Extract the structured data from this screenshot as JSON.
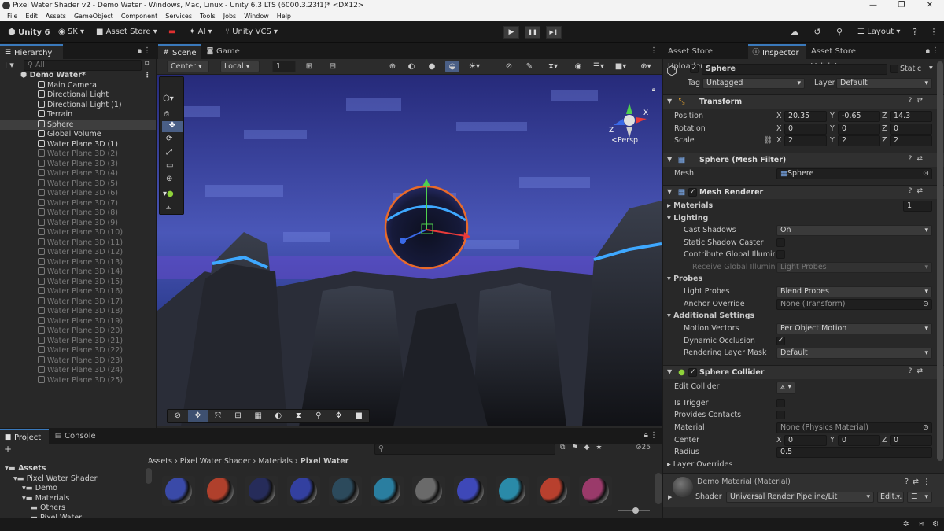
{
  "window": {
    "title": "Pixel Water Shader v2 - Demo Water - Windows, Mac, Linux - Unity 6.3 LTS (6000.3.23f1)* <DX12>",
    "controls": [
      "—",
      "❐",
      "✕"
    ]
  },
  "menu": [
    "File",
    "Edit",
    "Assets",
    "GameObject",
    "Component",
    "Services",
    "Tools",
    "Jobs",
    "Window",
    "Help"
  ],
  "toolbar": {
    "unity_label": "Unity 6",
    "account_label": "SK",
    "asset_store_label": "Asset Store",
    "ai_label": "AI",
    "vcs_label": "Unity VCS",
    "layout_label": "Layout",
    "play_glyph": "▶",
    "pause_glyph": "❚❚",
    "step_glyph": "▶❙"
  },
  "hierarchy": {
    "tab_label": "Hierarchy",
    "search_placeholder": "All",
    "scene_name": "Demo Water*",
    "items": [
      {
        "label": "Main Camera",
        "dim": false,
        "selected": false
      },
      {
        "label": "Directional Light",
        "dim": false,
        "selected": false
      },
      {
        "label": "Directional Light (1)",
        "dim": false,
        "selected": false
      },
      {
        "label": "Terrain",
        "dim": false,
        "selected": false
      },
      {
        "label": "Sphere",
        "dim": false,
        "selected": true
      },
      {
        "label": "Global Volume",
        "dim": false,
        "selected": false
      },
      {
        "label": "Water Plane 3D (1)",
        "dim": false,
        "selected": false
      },
      {
        "label": "Water Plane 3D (2)",
        "dim": true,
        "selected": false
      },
      {
        "label": "Water Plane 3D (3)",
        "dim": true,
        "selected": false
      },
      {
        "label": "Water Plane 3D (4)",
        "dim": true,
        "selected": false
      },
      {
        "label": "Water Plane 3D (5)",
        "dim": true,
        "selected": false
      },
      {
        "label": "Water Plane 3D (6)",
        "dim": true,
        "selected": false
      },
      {
        "label": "Water Plane 3D (7)",
        "dim": true,
        "selected": false
      },
      {
        "label": "Water Plane 3D (8)",
        "dim": true,
        "selected": false
      },
      {
        "label": "Water Plane 3D (9)",
        "dim": true,
        "selected": false
      },
      {
        "label": "Water Plane 3D (10)",
        "dim": true,
        "selected": false
      },
      {
        "label": "Water Plane 3D (11)",
        "dim": true,
        "selected": false
      },
      {
        "label": "Water Plane 3D (12)",
        "dim": true,
        "selected": false
      },
      {
        "label": "Water Plane 3D (13)",
        "dim": true,
        "selected": false
      },
      {
        "label": "Water Plane 3D (14)",
        "dim": true,
        "selected": false
      },
      {
        "label": "Water Plane 3D (15)",
        "dim": true,
        "selected": false
      },
      {
        "label": "Water Plane 3D (16)",
        "dim": true,
        "selected": false
      },
      {
        "label": "Water Plane 3D (17)",
        "dim": true,
        "selected": false
      },
      {
        "label": "Water Plane 3D (18)",
        "dim": true,
        "selected": false
      },
      {
        "label": "Water Plane 3D (19)",
        "dim": true,
        "selected": false
      },
      {
        "label": "Water Plane 3D (20)",
        "dim": true,
        "selected": false
      },
      {
        "label": "Water Plane 3D (21)",
        "dim": true,
        "selected": false
      },
      {
        "label": "Water Plane 3D (22)",
        "dim": true,
        "selected": false
      },
      {
        "label": "Water Plane 3D (23)",
        "dim": true,
        "selected": false
      },
      {
        "label": "Water Plane 3D (24)",
        "dim": true,
        "selected": false
      },
      {
        "label": "Water Plane 3D (25)",
        "dim": true,
        "selected": false
      }
    ]
  },
  "scene": {
    "tabs": [
      {
        "label": "Scene",
        "icon": "grid-icon"
      },
      {
        "label": "Game",
        "icon": "gamepad-icon"
      }
    ],
    "pivot_label": "Center",
    "space_label": "Local",
    "grid_size": "1",
    "persp_label": "<Persp",
    "gizmo_axes": {
      "x": "X",
      "z": "Z"
    }
  },
  "inspector": {
    "tabs": [
      "Asset Store Uploader",
      "Inspector",
      "Asset Store Validator"
    ],
    "object_name": "Sphere",
    "static_label": "Static",
    "tag_label": "Tag",
    "tag_value": "Untagged",
    "layer_label": "Layer",
    "layer_value": "Default",
    "transform": {
      "title": "Transform",
      "position_label": "Position",
      "rotation_label": "Rotation",
      "scale_label": "Scale",
      "position": [
        "20.35",
        "-0.65",
        "14.3"
      ],
      "rotation": [
        "0",
        "0",
        "0"
      ],
      "scale": [
        "2",
        "2",
        "2"
      ],
      "axes": [
        "X",
        "Y",
        "Z"
      ]
    },
    "mesh_filter": {
      "title": "Sphere (Mesh Filter)",
      "mesh_label": "Mesh",
      "mesh_value": "Sphere"
    },
    "mesh_renderer": {
      "title": "Mesh Renderer",
      "materials_label": "Materials",
      "materials_count": "1",
      "lighting_label": "Lighting",
      "cast_shadows_label": "Cast Shadows",
      "cast_shadows_value": "On",
      "static_shadow_label": "Static Shadow Caster",
      "contribute_gi_label": "Contribute Global Illuminati",
      "receive_gi_label": "Receive Global Illuminati",
      "receive_gi_value": "Light Probes",
      "probes_label": "Probes",
      "light_probes_label": "Light Probes",
      "light_probes_value": "Blend Probes",
      "anchor_override_label": "Anchor Override",
      "anchor_override_value": "None (Transform)",
      "additional_label": "Additional Settings",
      "motion_vectors_label": "Motion Vectors",
      "motion_vectors_value": "Per Object Motion",
      "dynamic_occlusion_label": "Dynamic Occlusion",
      "rendering_layer_label": "Rendering Layer Mask",
      "rendering_layer_value": "Default"
    },
    "sphere_collider": {
      "title": "Sphere Collider",
      "edit_collider_label": "Edit Collider",
      "is_trigger_label": "Is Trigger",
      "provides_contacts_label": "Provides Contacts",
      "material_label": "Material",
      "material_value": "None (Physics Material)",
      "center_label": "Center",
      "center": [
        "0",
        "0",
        "0"
      ],
      "radius_label": "Radius",
      "radius_value": "0.5",
      "layer_overrides_label": "Layer Overrides"
    },
    "material": {
      "name": "Demo Material (Material)",
      "shader_label": "Shader",
      "shader_value": "Universal Render Pipeline/Lit",
      "edit_label": "Edit..."
    }
  },
  "project": {
    "tabs": [
      "Project",
      "Console"
    ],
    "breadcrumb": [
      "Assets",
      "Pixel Water Shader",
      "Materials",
      "Pixel Water"
    ],
    "hidden_count": "25",
    "tree": [
      {
        "label": "Assets",
        "indent": 0,
        "bold": true
      },
      {
        "label": "Pixel Water Shader",
        "indent": 1,
        "bold": false
      },
      {
        "label": "Demo",
        "indent": 2,
        "bold": false
      },
      {
        "label": "Materials",
        "indent": 2,
        "bold": false
      },
      {
        "label": "Others",
        "indent": 3,
        "bold": false
      },
      {
        "label": "Pixel Water",
        "indent": 3,
        "bold": false
      }
    ],
    "thumb_colors": [
      "#3a4aa8",
      "#b0402c",
      "#262c5a",
      "#3340a0",
      "#2c4a5c",
      "#2a7ea0",
      "#6a6a6a",
      "#3e48b8",
      "#2a8aa8",
      "#b8402e",
      "#9a3a6a"
    ]
  }
}
